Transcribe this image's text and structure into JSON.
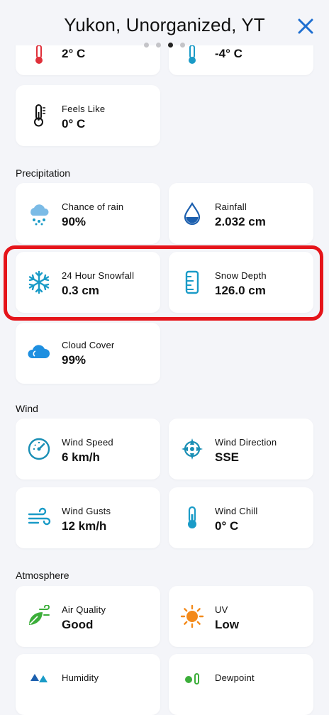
{
  "header": {
    "title": "Yukon, Unorganized, YT",
    "close_icon": "close-icon"
  },
  "pager": {
    "total": 4,
    "active": 2
  },
  "temperature": {
    "left_value": "2° C",
    "right_value": "-4° C",
    "feels_like": {
      "label": "Feels Like",
      "value": "0° C"
    }
  },
  "precipitation": {
    "title": "Precipitation",
    "chance_rain": {
      "label": "Chance of rain",
      "value": "90%"
    },
    "rainfall": {
      "label": "Rainfall",
      "value": "2.032 cm"
    },
    "snowfall": {
      "label": "24 Hour Snowfall",
      "value": "0.3 cm"
    },
    "snow_depth": {
      "label": "Snow Depth",
      "value": "126.0 cm"
    },
    "cloud_cover": {
      "label": "Cloud Cover",
      "value": "99%"
    }
  },
  "wind": {
    "title": "Wind",
    "speed": {
      "label": "Wind Speed",
      "value": "6 km/h"
    },
    "direction": {
      "label": "Wind Direction",
      "value": "SSE"
    },
    "gusts": {
      "label": "Wind Gusts",
      "value": "12 km/h"
    },
    "chill": {
      "label": "Wind Chill",
      "value": "0° C"
    }
  },
  "atmosphere": {
    "title": "Atmosphere",
    "air_quality": {
      "label": "Air Quality",
      "value": "Good"
    },
    "uv": {
      "label": "UV",
      "value": "Low"
    },
    "humidity": {
      "label": "Humidity"
    },
    "dewpoint": {
      "label": "Dewpoint"
    }
  },
  "colors": {
    "accent_blue": "#1f6fd1",
    "icon_teal": "#1a9bc7",
    "highlight_red": "#e5141a",
    "air_green": "#3cae3a",
    "uv_orange": "#f38a1b"
  }
}
